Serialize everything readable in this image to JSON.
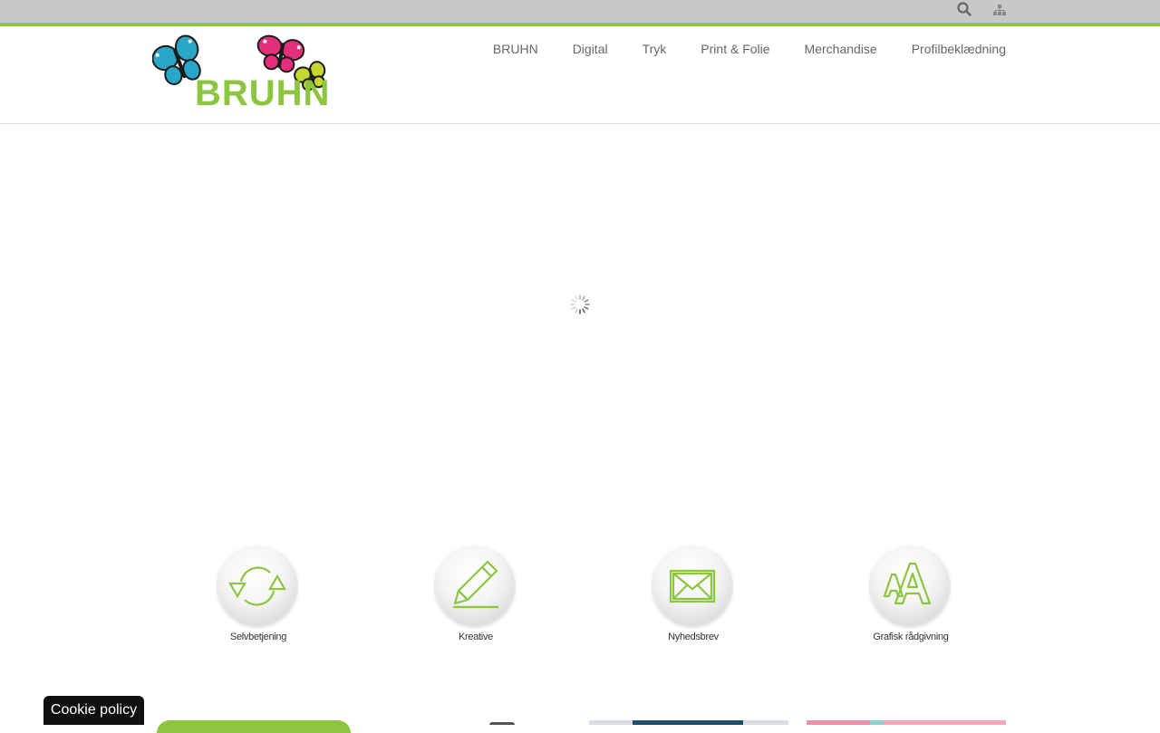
{
  "top_icons": {
    "search": "search-icon",
    "sitemap": "sitemap-icon"
  },
  "logo": {
    "text": "BRUHN"
  },
  "nav": {
    "items": [
      {
        "label": "BRUHN"
      },
      {
        "label": "Digital"
      },
      {
        "label": "Tryk"
      },
      {
        "label": "Print & Folie"
      },
      {
        "label": "Merchandise"
      },
      {
        "label": "Profilbeklædning"
      }
    ]
  },
  "slider": {
    "loading_icon": "loading-spinner-icon"
  },
  "features": [
    {
      "label": "Selvbetjening",
      "icon": "refresh-icon"
    },
    {
      "label": "Kreative",
      "icon": "pencil-icon"
    },
    {
      "label": "Nyhedsbrev",
      "icon": "envelope-icon"
    },
    {
      "label": "Grafisk rådgivning",
      "icon": "font-icon"
    }
  ],
  "cookie": {
    "label": "Cookie policy"
  },
  "colors": {
    "brand_green": "#8cc63f",
    "topbar_gray": "#c8c8c8",
    "butterfly_blue": "#2aa6c8",
    "butterfly_pink": "#e4307a",
    "butterfly_lime": "#c8d630"
  }
}
